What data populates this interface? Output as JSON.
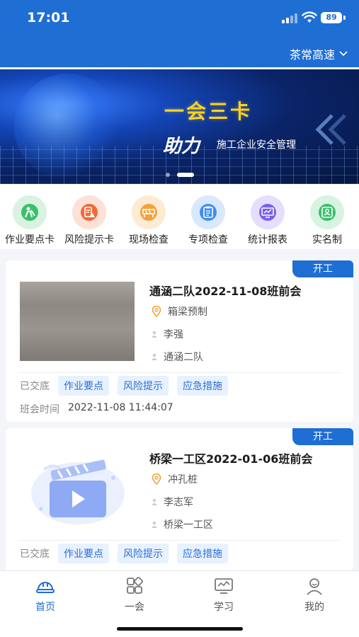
{
  "status_bar": {
    "time": "17:01",
    "battery": "89"
  },
  "header": {
    "project": "茶常高速"
  },
  "banner": {
    "title": "一会三卡",
    "subtitle_strong": "助力",
    "subtitle": "施工企业安全管理"
  },
  "menu": {
    "items": [
      {
        "label": "作业要点卡",
        "icon": "worker-icon",
        "color": "#3cbf6b"
      },
      {
        "label": "风险提示卡",
        "icon": "risk-warning-icon",
        "color": "#f06a3c"
      },
      {
        "label": "现场检查",
        "icon": "site-barrier-icon",
        "color": "#f3a23b"
      },
      {
        "label": "专项检查",
        "icon": "clipboard-icon",
        "color": "#3f8ef2"
      },
      {
        "label": "统计报表",
        "icon": "monitor-chart-icon",
        "color": "#7b5ff0"
      },
      {
        "label": "实名制",
        "icon": "id-card-icon",
        "color": "#3cbf6b"
      }
    ]
  },
  "cards": [
    {
      "tag": "开工",
      "title": "通涵二队2022-11-08班前会",
      "location": "箱梁预制",
      "person": "李强",
      "team": "通涵二队",
      "handover_label": "已交底",
      "chips": [
        "作业要点",
        "风险提示",
        "应急措施"
      ],
      "time_label": "班会时间",
      "time_value": "2022-11-08 11:44:07"
    },
    {
      "tag": "开工",
      "title": "桥梁一工区2022-01-06班前会",
      "location": "冲孔桩",
      "person": "李志军",
      "team": "桥梁一工区",
      "handover_label": "已交底",
      "chips": [
        "作业要点",
        "风险提示",
        "应急措施"
      ]
    }
  ],
  "tabbar": {
    "items": [
      {
        "label": "首页",
        "icon": "home-helmet-icon",
        "active": true
      },
      {
        "label": "一会",
        "icon": "grid-apps-icon",
        "active": false
      },
      {
        "label": "学习",
        "icon": "learning-monitor-icon",
        "active": false
      },
      {
        "label": "我的",
        "icon": "user-icon",
        "active": false
      }
    ]
  },
  "colors": {
    "primary": "#1f6ed4",
    "chip_bg": "#e8f1fe",
    "banner_title": "#ffd21e"
  }
}
